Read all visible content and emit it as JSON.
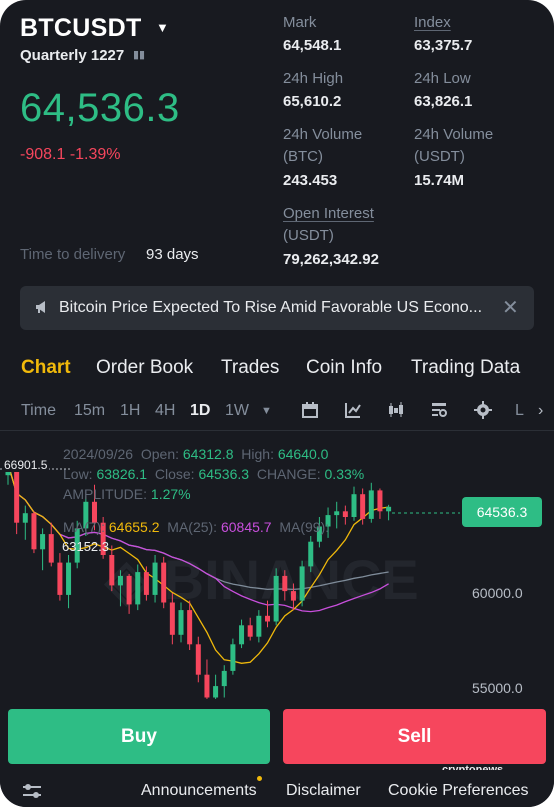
{
  "header": {
    "symbol": "BTCUSDT",
    "contract": "Quarterly 1227",
    "last_price": "64,536.3",
    "change": "-908.1 -1.39%",
    "delivery_label": "Time to delivery",
    "delivery_value": "93 days"
  },
  "stats": {
    "mark_label": "Mark",
    "mark_value": "64,548.1",
    "index_label": "Index",
    "index_value": "63,375.7",
    "high_label": "24h High",
    "high_value": "65,610.2",
    "low_label": "24h Low",
    "low_value": "63,826.1",
    "vol_btc_label": "24h Volume",
    "vol_btc_unit": "(BTC)",
    "vol_btc_value": "243.453",
    "vol_usdt_label": "24h Volume",
    "vol_usdt_unit": "(USDT)",
    "vol_usdt_value": "15.74M",
    "oi_label": "Open Interest",
    "oi_unit": "(USDT)",
    "oi_value": "79,262,342.92"
  },
  "news": {
    "text": "Bitcoin Price Expected To Rise Amid Favorable US Econo...",
    "close": "✕"
  },
  "tabs": [
    "Chart",
    "Order Book",
    "Trades",
    "Coin Info",
    "Trading Data"
  ],
  "toolbar": {
    "intervals": [
      "Time",
      "15m",
      "1H",
      "4H",
      "1D",
      "1W"
    ],
    "active": "1D",
    "more": "L"
  },
  "chart_info": {
    "date": "2024/09/26",
    "open_label": "Open:",
    "open": "64312.8",
    "high_label": "High:",
    "high": "64640.0",
    "low_label": "Low:",
    "low": "63826.1",
    "close_label": "Close:",
    "close": "64536.3",
    "change_label": "CHANGE:",
    "change": "0.33%",
    "amp_label": "AMPLITUDE:",
    "amp": "1.27%",
    "ma7_label": "MA(7):",
    "ma7": "64655.2",
    "ma25_label": "MA(25):",
    "ma25": "60845.7",
    "ma99_label": "MA(99):"
  },
  "chart_labels": {
    "current_price": "64536.3",
    "axis": [
      "60000.0",
      "55000.0"
    ],
    "visible_high": "66901.5",
    "visible_low": "63152.3"
  },
  "buttons": {
    "buy": "Buy",
    "sell": "Sell"
  },
  "footer": {
    "announcements": "Announcements",
    "disclaimer": "Disclaimer",
    "cookies": "Cookie Preferences",
    "watermark": "cryptonews"
  },
  "colors": {
    "up": "#2ebd85",
    "down": "#f6465d",
    "accent": "#f0b90b",
    "ma7": "#f0b90b",
    "ma25": "#c84fdc",
    "ma99": "#7f8c9a"
  },
  "candles": [
    [
      66200,
      66900,
      65700,
      66800
    ],
    [
      66400,
      66600,
      63100,
      63700
    ],
    [
      63700,
      64600,
      62800,
      64200
    ],
    [
      64200,
      64300,
      62100,
      62300
    ],
    [
      62300,
      63400,
      61200,
      63100
    ],
    [
      63100,
      63700,
      61400,
      61600
    ],
    [
      61600,
      62100,
      59600,
      59900
    ],
    [
      59900,
      62000,
      59200,
      61600
    ],
    [
      61600,
      63800,
      61300,
      63400
    ],
    [
      63400,
      65100,
      63000,
      64800
    ],
    [
      64800,
      65700,
      63300,
      63700
    ],
    [
      63700,
      64000,
      61800,
      62000
    ],
    [
      62000,
      62500,
      60100,
      60400
    ],
    [
      60400,
      61200,
      59300,
      60900
    ],
    [
      60900,
      61000,
      58900,
      59400
    ],
    [
      59400,
      61500,
      59100,
      61100
    ],
    [
      61100,
      61400,
      59600,
      59900
    ],
    [
      59900,
      62000,
      59500,
      61600
    ],
    [
      61600,
      61900,
      59200,
      59500
    ],
    [
      59500,
      60000,
      57300,
      57800
    ],
    [
      57800,
      59500,
      57400,
      59100
    ],
    [
      59100,
      59600,
      57000,
      57300
    ],
    [
      57300,
      57700,
      55300,
      55700
    ],
    [
      55700,
      56500,
      54200,
      54500
    ],
    [
      54500,
      55700,
      53600,
      55100
    ],
    [
      55100,
      56200,
      54500,
      55900
    ],
    [
      55900,
      57600,
      55700,
      57300
    ],
    [
      57300,
      58600,
      57100,
      58300
    ],
    [
      58300,
      58700,
      57500,
      57700
    ],
    [
      57700,
      59100,
      57400,
      58800
    ],
    [
      58800,
      59600,
      58200,
      58500
    ],
    [
      58500,
      61300,
      58300,
      60900
    ],
    [
      60900,
      61200,
      59600,
      60100
    ],
    [
      60100,
      60500,
      59100,
      59600
    ],
    [
      59600,
      61700,
      59300,
      61400
    ],
    [
      61400,
      63000,
      61100,
      62700
    ],
    [
      62700,
      64000,
      62400,
      63500
    ],
    [
      63500,
      64500,
      62900,
      64100
    ],
    [
      64100,
      64800,
      63400,
      64300
    ],
    [
      64300,
      64600,
      63600,
      64000
    ],
    [
      64000,
      65600,
      63800,
      65200
    ],
    [
      65200,
      65500,
      63600,
      63900
    ],
    [
      63900,
      65800,
      63700,
      65400
    ],
    [
      65400,
      65500,
      63900,
      64300
    ],
    [
      64300,
      64640,
      63826,
      64536
    ]
  ]
}
